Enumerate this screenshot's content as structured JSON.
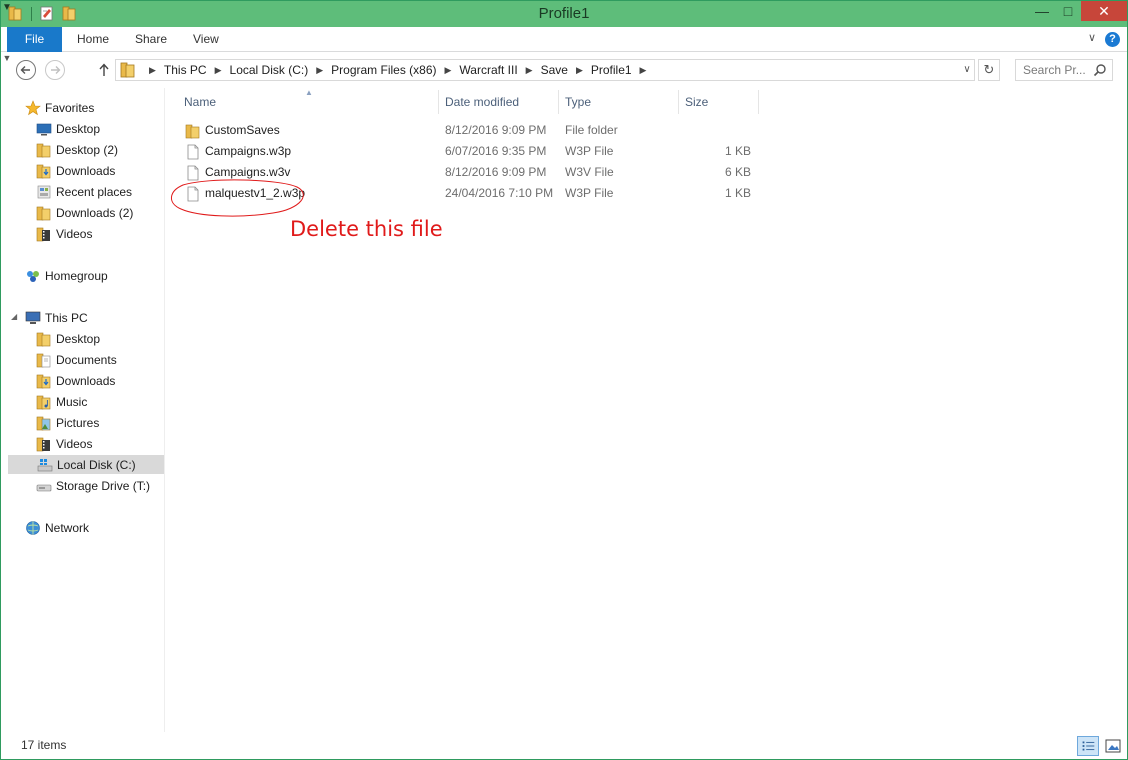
{
  "window": {
    "title": "Profile1"
  },
  "colors": {
    "titlebar": "#5ebd7a",
    "file_tab": "#1979ca",
    "close_button": "#c7463a",
    "annotation": "#e01a1a",
    "selected_nav": "#d9d9d9"
  },
  "ribbon": {
    "tabs": [
      "File",
      "Home",
      "Share",
      "View"
    ]
  },
  "address": {
    "crumbs": [
      "This PC",
      "Local Disk (C:)",
      "Program Files (x86)",
      "Warcraft III",
      "Save",
      "Profile1"
    ]
  },
  "search": {
    "placeholder": "Search Pr..."
  },
  "navpane": {
    "favorites": {
      "label": "Favorites",
      "icon": "star-icon",
      "items": [
        {
          "label": "Desktop",
          "icon": "desktop-icon"
        },
        {
          "label": "Desktop (2)",
          "icon": "folder-icon"
        },
        {
          "label": "Downloads",
          "icon": "downloads-icon"
        },
        {
          "label": "Recent places",
          "icon": "recent-places-icon"
        },
        {
          "label": "Downloads (2)",
          "icon": "folder-icon"
        },
        {
          "label": "Videos",
          "icon": "videos-icon"
        }
      ]
    },
    "homegroup": {
      "label": "Homegroup",
      "icon": "homegroup-icon"
    },
    "thispc": {
      "label": "This PC",
      "icon": "computer-icon",
      "items": [
        {
          "label": "Desktop",
          "icon": "folder-icon"
        },
        {
          "label": "Documents",
          "icon": "documents-icon"
        },
        {
          "label": "Downloads",
          "icon": "downloads-icon"
        },
        {
          "label": "Music",
          "icon": "music-icon"
        },
        {
          "label": "Pictures",
          "icon": "pictures-icon"
        },
        {
          "label": "Videos",
          "icon": "videos-icon"
        },
        {
          "label": "Local Disk (C:)",
          "icon": "drive-c-icon"
        },
        {
          "label": "Storage Drive (T:)",
          "icon": "drive-icon"
        }
      ]
    },
    "network": {
      "label": "Network",
      "icon": "network-icon"
    }
  },
  "columns": {
    "name": "Name",
    "date": "Date modified",
    "type": "Type",
    "size": "Size"
  },
  "files": [
    {
      "name": "CustomSaves",
      "date": "8/12/2016 9:09 PM",
      "type": "File folder",
      "size": "",
      "icon": "folder-icon"
    },
    {
      "name": "Campaigns.w3p",
      "date": "6/07/2016 9:35 PM",
      "type": "W3P File",
      "size": "1 KB",
      "icon": "file-icon"
    },
    {
      "name": "Campaigns.w3v",
      "date": "8/12/2016 9:09 PM",
      "type": "W3V File",
      "size": "6 KB",
      "icon": "file-icon"
    },
    {
      "name": "malquestv1_2.w3p",
      "date": "24/04/2016 7:10 PM",
      "type": "W3P File",
      "size": "1 KB",
      "icon": "file-icon"
    }
  ],
  "annotation": {
    "text": "Delete this file"
  },
  "status": {
    "count": "17 items"
  }
}
